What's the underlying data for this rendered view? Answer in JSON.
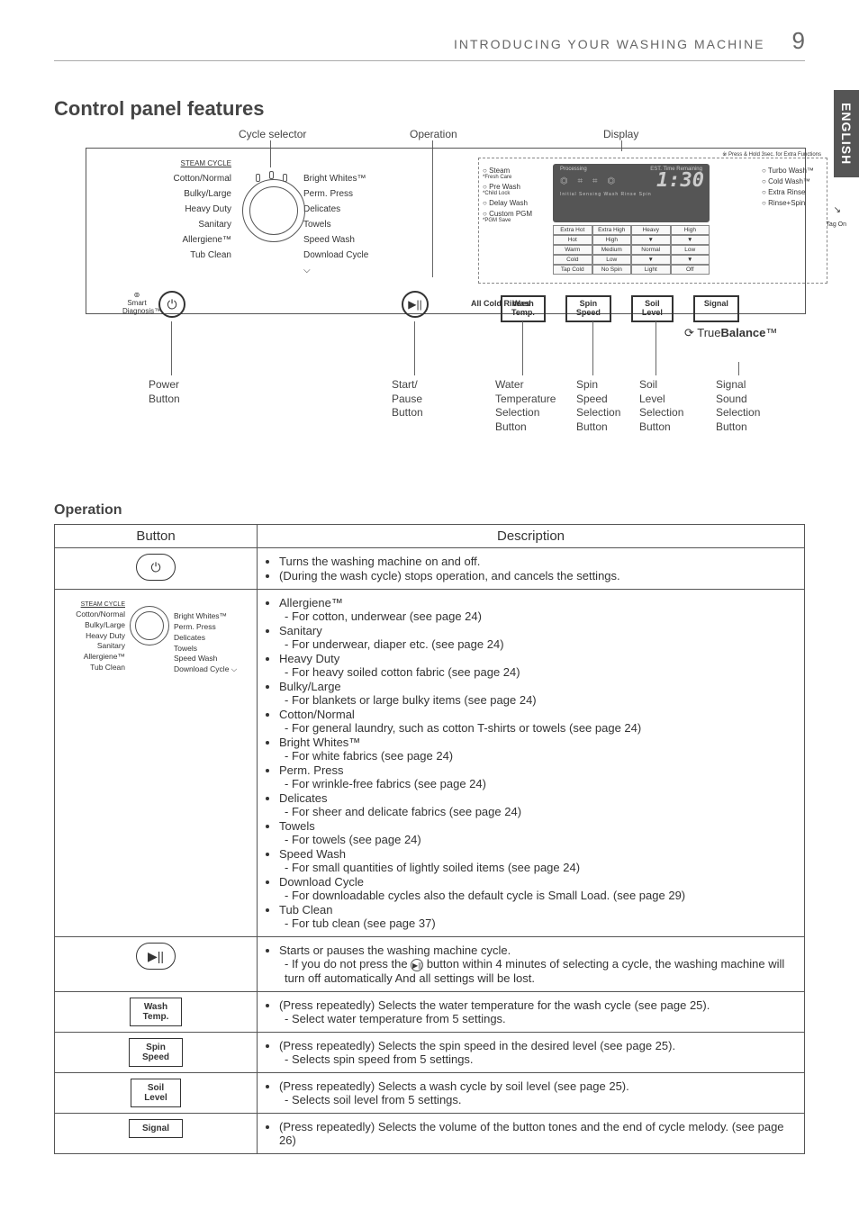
{
  "header": {
    "section_title": "INTRODUCING YOUR WASHING MACHINE",
    "page_number": "9",
    "language_tab": "ENGLISH"
  },
  "section_heading": "Control panel features",
  "diagram": {
    "top_labels": {
      "cycle_selector": "Cycle selector",
      "operation": "Operation",
      "display": "Display"
    },
    "dial": {
      "steam_cycle_label": "STEAM CYCLE",
      "left": [
        "Cotton/Normal",
        "Bulky/Large",
        "Heavy Duty",
        "Sanitary",
        "Allergiene™",
        "Tub Clean"
      ],
      "right": [
        "Bright Whites™",
        "Perm. Press",
        "Delicates",
        "Towels",
        "Speed Wash",
        "Download Cycle ⌵"
      ]
    },
    "power_icon": "⏻",
    "smart_diag": "Smart Diagnosis™",
    "startpause_icon": "▶||",
    "display": {
      "note": "※ Press & Hold 3sec. for Extra Functions",
      "left_opts": [
        {
          "main": "Steam",
          "sub": "*Fresh Care"
        },
        {
          "main": "Pre Wash",
          "sub": "*Child Lock"
        },
        {
          "main": "Delay Wash",
          "sub": ""
        },
        {
          "main": "Custom PGM",
          "sub": "*PGM Save"
        }
      ],
      "lcd": {
        "processing": "Processing",
        "est": "EST. Time Remaining",
        "time": "1:30",
        "icon_row": "⏣ ⌗ ⌗ ⏣",
        "irw": "Initial Sensing  Wash  Rinse  Spin"
      },
      "grid": {
        "cols": [
          "",
          "",
          "",
          ""
        ],
        "rows": [
          [
            "Extra Hot",
            "Extra High",
            "Heavy",
            "High"
          ],
          [
            "Hot",
            "High",
            "▼",
            "▼"
          ],
          [
            "Warm",
            "Medium",
            "Normal",
            "Low"
          ],
          [
            "Cold",
            "Low",
            "▼",
            "▼"
          ],
          [
            "Tap Cold",
            "No Spin",
            "Light",
            "Off"
          ]
        ]
      },
      "right_opts": [
        "Turbo Wash™",
        "Cold Wash™",
        "Extra Rinse",
        "Rinse+Spin"
      ],
      "tag_on": "Tag On",
      "chevron": "↘"
    },
    "ctrl_buttons": {
      "wash": "Wash\nTemp.",
      "spin": "Spin\nSpeed",
      "soil": "Soil\nLevel",
      "signal": "Signal"
    },
    "all_cold": "All Cold Rinses",
    "truebalance_prefix": "⟳ True",
    "truebalance_bold": "Balance",
    "truebalance_tm": "™",
    "bottom_captions": {
      "power": "Power\nButton",
      "startpause": "Start/\nPause\nButton",
      "water": "Water\nTemperature\nSelection\nButton",
      "spin": "Spin\nSpeed\nSelection\nButton",
      "soil": "Soil\nLevel\nSelection\nButton",
      "signal": "Signal\nSound\nSelection\nButton"
    }
  },
  "operation_heading": "Operation",
  "table": {
    "head_button": "Button",
    "head_desc": "Description",
    "rows": {
      "power": {
        "icon": "⏻",
        "lines": [
          "Turns the washing machine on and off.",
          "(During the wash cycle) stops operation, and cancels the settings."
        ]
      },
      "cycles": [
        {
          "name": "Allergiene™",
          "desc": "- For cotton, underwear (see page 24)"
        },
        {
          "name": "Sanitary",
          "desc": "- For underwear, diaper etc. (see page 24)"
        },
        {
          "name": "Heavy Duty",
          "desc": "- For heavy soiled cotton fabric (see page 24)"
        },
        {
          "name": "Bulky/Large",
          "desc": "- For blankets or large bulky items (see page 24)"
        },
        {
          "name": "Cotton/Normal",
          "desc": "- For general laundry, such as cotton T-shirts or towels (see page 24)"
        },
        {
          "name": "Bright Whites™",
          "desc": "- For white fabrics (see page 24)"
        },
        {
          "name": "Perm. Press",
          "desc": "- For wrinkle-free fabrics (see page 24)"
        },
        {
          "name": "Delicates",
          "desc": "- For sheer and delicate fabrics (see page 24)"
        },
        {
          "name": "Towels",
          "desc": "- For towels (see page 24)"
        },
        {
          "name": "Speed Wash",
          "desc": "- For small quantities of lightly soiled items (see page 24)"
        },
        {
          "name": "Download Cycle",
          "desc": "- For downloadable cycles also the default cycle is Small Load. (see page 29)"
        },
        {
          "name": "Tub Clean",
          "desc": "- For tub clean (see page 37)"
        }
      ],
      "startpause": {
        "icon": "▶||",
        "line1": "Starts or pauses the washing machine cycle.",
        "line2_pre": "- If you do not press the ",
        "line2_post": " button within 4 minutes of selecting a cycle, the washing machine will turn off automatically  And all settings will be lost."
      },
      "wash": {
        "label": "Wash\nTemp.",
        "line1": "(Press repeatedly) Selects the water temperature for the wash cycle (see page 25).",
        "line2": "- Select water temperature from 5 settings."
      },
      "spin": {
        "label": "Spin\nSpeed",
        "line1": "(Press repeatedly) Selects the spin speed in the desired level (see page 25).",
        "line2": "- Selects spin speed from 5 settings."
      },
      "soil": {
        "label": "Soil\nLevel",
        "line1": "(Press repeatedly) Selects a wash cycle by soil level (see page 25).",
        "line2": "- Selects soil level from 5 settings."
      },
      "signal": {
        "label": "Signal",
        "line1": "(Press repeatedly) Selects the volume of the button tones and the end of cycle melody. (see page 26)"
      }
    }
  }
}
